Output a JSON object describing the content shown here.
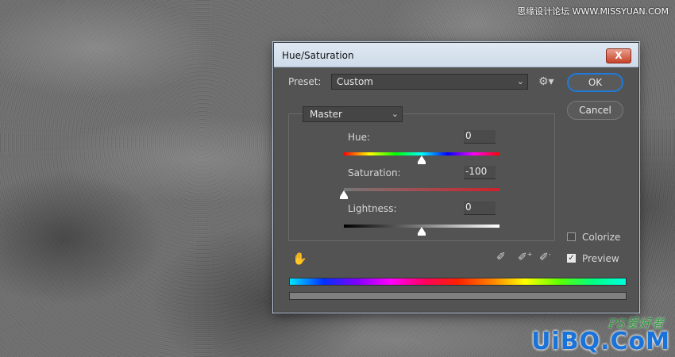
{
  "watermark": {
    "top_text": "思缘设计论坛 WWW.MISSYUAN.COM",
    "bottom_text": "UiBQ.CoM",
    "ps_text": "PS爱好者"
  },
  "dialog": {
    "title": "Hue/Saturation",
    "close_label": "X",
    "preset_label": "Preset:",
    "preset_value": "Custom",
    "ok_label": "OK",
    "cancel_label": "Cancel",
    "channel_value": "Master",
    "hue": {
      "label": "Hue:",
      "value": "0",
      "slider_position": 0.5
    },
    "saturation": {
      "label": "Saturation:",
      "value": "-100",
      "slider_position": 0.0
    },
    "lightness": {
      "label": "Lightness:",
      "value": "0",
      "slider_position": 0.5
    },
    "colorize": {
      "label": "Colorize",
      "checked": false
    },
    "preview": {
      "label": "Preview",
      "checked": true
    },
    "icons": [
      "settings-gear-icon",
      "targeted-adjustment-hand-icon",
      "eyedropper-icon",
      "eyedropper-plus-icon",
      "eyedropper-minus-icon"
    ]
  }
}
